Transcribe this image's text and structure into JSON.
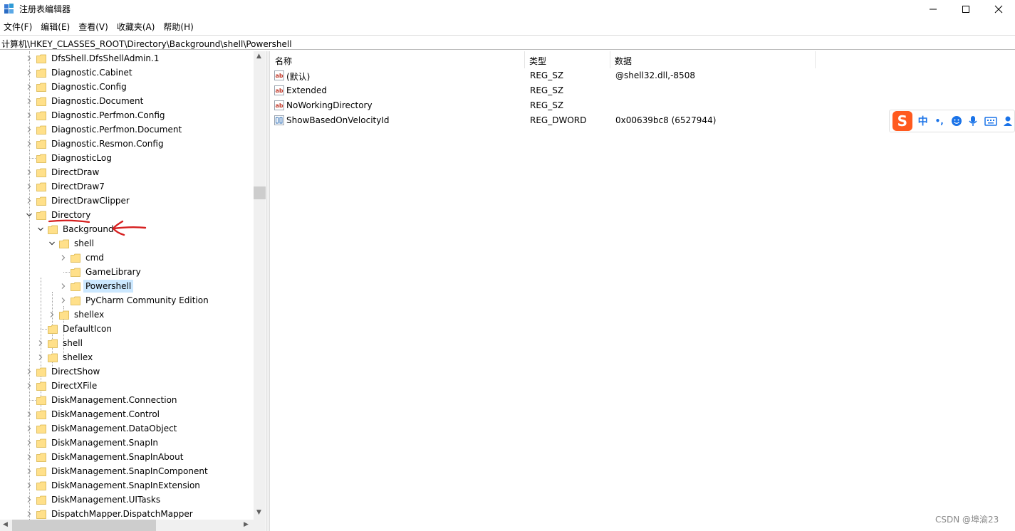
{
  "window": {
    "title": "注册表编辑器",
    "minimize_glyph": "—",
    "maximize_glyph": "☐",
    "close_glyph": "✕"
  },
  "menu": [
    "文件(F)",
    "编辑(E)",
    "查看(V)",
    "收藏夹(A)",
    "帮助(H)"
  ],
  "address": "计算机\\HKEY_CLASSES_ROOT\\Directory\\Background\\shell\\Powershell",
  "tree": [
    {
      "label": "DfsShell.DfsShellAdmin.1",
      "level": 0,
      "expander": "collapsed"
    },
    {
      "label": "Diagnostic.Cabinet",
      "level": 0,
      "expander": "collapsed"
    },
    {
      "label": "Diagnostic.Config",
      "level": 0,
      "expander": "collapsed"
    },
    {
      "label": "Diagnostic.Document",
      "level": 0,
      "expander": "collapsed"
    },
    {
      "label": "Diagnostic.Perfmon.Config",
      "level": 0,
      "expander": "collapsed"
    },
    {
      "label": "Diagnostic.Perfmon.Document",
      "level": 0,
      "expander": "collapsed"
    },
    {
      "label": "Diagnostic.Resmon.Config",
      "level": 0,
      "expander": "collapsed"
    },
    {
      "label": "DiagnosticLog",
      "level": 0,
      "expander": "none"
    },
    {
      "label": "DirectDraw",
      "level": 0,
      "expander": "collapsed"
    },
    {
      "label": "DirectDraw7",
      "level": 0,
      "expander": "collapsed"
    },
    {
      "label": "DirectDrawClipper",
      "level": 0,
      "expander": "collapsed"
    },
    {
      "label": "Directory",
      "level": 0,
      "expander": "expanded"
    },
    {
      "label": "Background",
      "level": 1,
      "expander": "expanded"
    },
    {
      "label": "shell",
      "level": 2,
      "expander": "expanded"
    },
    {
      "label": "cmd",
      "level": 3,
      "expander": "collapsed"
    },
    {
      "label": "GameLibrary",
      "level": 3,
      "expander": "none"
    },
    {
      "label": "Powershell",
      "level": 3,
      "expander": "collapsed",
      "selected": true
    },
    {
      "label": "PyCharm Community Edition",
      "level": 3,
      "expander": "collapsed"
    },
    {
      "label": "shellex",
      "level": 2,
      "expander": "collapsed"
    },
    {
      "label": "DefaultIcon",
      "level": 1,
      "expander": "none"
    },
    {
      "label": "shell",
      "level": 1,
      "expander": "collapsed"
    },
    {
      "label": "shellex",
      "level": 1,
      "expander": "collapsed"
    },
    {
      "label": "DirectShow",
      "level": 0,
      "expander": "collapsed"
    },
    {
      "label": "DirectXFile",
      "level": 0,
      "expander": "collapsed"
    },
    {
      "label": "DiskManagement.Connection",
      "level": 0,
      "expander": "none"
    },
    {
      "label": "DiskManagement.Control",
      "level": 0,
      "expander": "collapsed"
    },
    {
      "label": "DiskManagement.DataObject",
      "level": 0,
      "expander": "collapsed"
    },
    {
      "label": "DiskManagement.SnapIn",
      "level": 0,
      "expander": "collapsed"
    },
    {
      "label": "DiskManagement.SnapInAbout",
      "level": 0,
      "expander": "collapsed"
    },
    {
      "label": "DiskManagement.SnapInComponent",
      "level": 0,
      "expander": "collapsed"
    },
    {
      "label": "DiskManagement.SnapInExtension",
      "level": 0,
      "expander": "collapsed"
    },
    {
      "label": "DiskManagement.UITasks",
      "level": 0,
      "expander": "collapsed"
    },
    {
      "label": "DispatchMapper.DispatchMapper",
      "level": 0,
      "expander": "collapsed"
    }
  ],
  "columns": {
    "name": "名称",
    "type": "类型",
    "data": "数据"
  },
  "values": [
    {
      "name": "(默认)",
      "type": "REG_SZ",
      "data": "@shell32.dll,-8508",
      "icon": "string-value-icon"
    },
    {
      "name": "Extended",
      "type": "REG_SZ",
      "data": "",
      "icon": "string-value-icon"
    },
    {
      "name": "NoWorkingDirectory",
      "type": "REG_SZ",
      "data": "",
      "icon": "string-value-icon"
    },
    {
      "name": "ShowBasedOnVelocityId",
      "type": "REG_DWORD",
      "data": "0x00639bc8 (6527944)",
      "icon": "binary-value-icon"
    }
  ],
  "ime": {
    "logo": "S",
    "mode": "中",
    "punct": "•,"
  },
  "watermark": "CSDN @埠渝23",
  "colors": {
    "folder": "#ffe08a",
    "folder_edge": "#d8b248",
    "selection": "#cce8ff",
    "annotation": "#d62020",
    "ime_orange": "#ff5a1f",
    "ime_blue": "#1a73e8"
  }
}
